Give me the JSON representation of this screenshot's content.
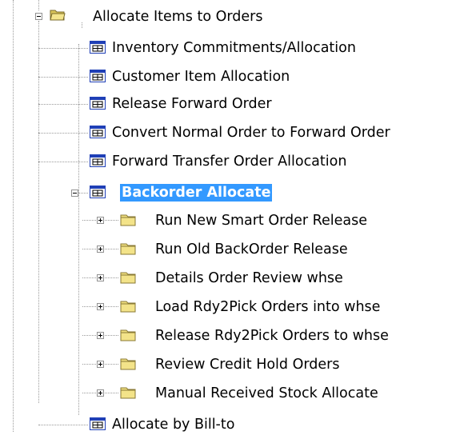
{
  "tree": {
    "root": {
      "label": "Allocate Items to Orders",
      "icon": "open-folder-icon"
    },
    "forms_before": [
      {
        "label": "Inventory Commitments/Allocation",
        "icon": "form-window-icon"
      },
      {
        "label": "Customer Item Allocation",
        "icon": "form-window-icon"
      },
      {
        "label": "Release Forward Order",
        "icon": "form-window-icon"
      },
      {
        "label": "Convert Normal Order to Forward Order",
        "icon": "form-window-icon"
      },
      {
        "label": "Forward Transfer Order Allocation",
        "icon": "form-window-icon"
      }
    ],
    "selected": {
      "label": "Backorder Allocate",
      "icon": "form-window-icon"
    },
    "subfolders": [
      {
        "label": "Run New Smart Order Release",
        "icon": "folder-icon"
      },
      {
        "label": "Run Old BackOrder Release",
        "icon": "folder-icon"
      },
      {
        "label": "Details Order Review whse",
        "icon": "folder-icon"
      },
      {
        "label": "Load Rdy2Pick Orders into whse",
        "icon": "folder-icon"
      },
      {
        "label": "Release Rdy2Pick Orders to whse",
        "icon": "folder-icon"
      },
      {
        "label": "Review Credit Hold Orders",
        "icon": "folder-icon"
      },
      {
        "label": "Manual Received Stock Allocate",
        "icon": "folder-icon"
      }
    ],
    "forms_after": [
      {
        "label": "Allocate by Bill-to",
        "icon": "form-window-icon"
      }
    ]
  },
  "colors": {
    "selection": "#3399ff",
    "folder": "#f0df7e",
    "form_title": "#1f3fb6"
  }
}
